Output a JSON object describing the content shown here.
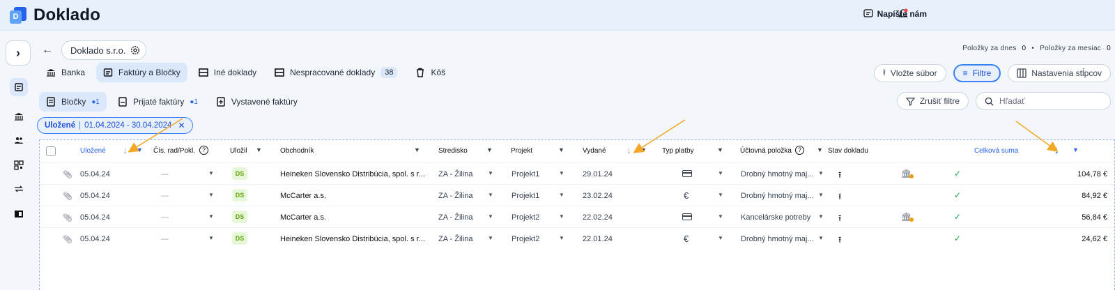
{
  "app": {
    "brand": "Doklado",
    "logo_letter": "D",
    "contact_label": "Napíšte nám"
  },
  "header": {
    "company": "Doklado s.r.o.",
    "count_today_label": "Položky za dnes",
    "count_today": "0",
    "count_month_label": "Položky za mesiac",
    "count_month": "0"
  },
  "tabs": [
    {
      "label": "Banka",
      "icon": "bank-icon"
    },
    {
      "label": "Faktúry a Bločky",
      "icon": "receipt-icon",
      "active": true
    },
    {
      "label": "Iné doklady",
      "icon": "document-icon"
    },
    {
      "label": "Nespracované doklady",
      "icon": "inbox-icon",
      "badge": "38"
    },
    {
      "label": "Kôš",
      "icon": "trash-icon"
    }
  ],
  "actions": {
    "upload": "Vložte súbor",
    "filter": "Filtre",
    "columns": "Nastavenia stĺpcov"
  },
  "subtabs": [
    {
      "label": "Bločky",
      "dot": "●1",
      "active": true
    },
    {
      "label": "Prijaté faktúry",
      "dot": "●1"
    },
    {
      "label": "Vystavené faktúry"
    }
  ],
  "filters": {
    "clear_label": "Zrušiť filtre",
    "search_placeholder": "Hľadať",
    "chip_key": "Uložené",
    "chip_value": "01.04.2024 - 30.04.2024",
    "chip_close": "✕"
  },
  "table": {
    "columns": {
      "saved": "Uložené",
      "doc_number": "Čís. rad/Pokl.",
      "saved_by": "Uložil",
      "merchant": "Obchodník",
      "center": "Stredisko",
      "project": "Projekt",
      "issued": "Vydané",
      "payment_type": "Typ platby",
      "account_item": "Účtovná položka",
      "doc_state": "Stav dokladu",
      "total": "Celková suma"
    },
    "rows": [
      {
        "saved": "05.04.24",
        "doc_number": "—",
        "saved_by": "DS",
        "merchant": "Heineken Slovensko Distribúcia, spol. s r...",
        "center": "ZA - Žilina",
        "project": "Projekt1",
        "issued": "29.01.24",
        "payment": "card",
        "account_item": "Drobný hmotný maj...",
        "bank_flag": true,
        "total": "104,78 €"
      },
      {
        "saved": "05.04.24",
        "doc_number": "—",
        "saved_by": "DS",
        "merchant": "McCarter a.s.",
        "center": "ZA - Žilina",
        "project": "Projekt1",
        "issued": "23.02.24",
        "payment": "cash",
        "account_item": "Drobný hmotný maj...",
        "bank_flag": false,
        "total": "84,92 €"
      },
      {
        "saved": "05.04.24",
        "doc_number": "—",
        "saved_by": "DS",
        "merchant": "McCarter a.s.",
        "center": "ZA - Žilina",
        "project": "Projekt2",
        "issued": "22.02.24",
        "payment": "card",
        "account_item": "Kancelárske potreby",
        "bank_flag": true,
        "total": "56,84 €"
      },
      {
        "saved": "05.04.24",
        "doc_number": "—",
        "saved_by": "DS",
        "merchant": "Heineken Slovensko Distribúcia, spol. s r...",
        "center": "ZA - Žilina",
        "project": "Projekt2",
        "issued": "22.01.24",
        "payment": "cash",
        "account_item": "Drobný hmotný maj...",
        "bank_flag": false,
        "total": "24,62 €"
      }
    ]
  },
  "colors": {
    "accent": "#2563eb",
    "annotation_arrow": "#f5a623",
    "success": "#16a34a"
  }
}
